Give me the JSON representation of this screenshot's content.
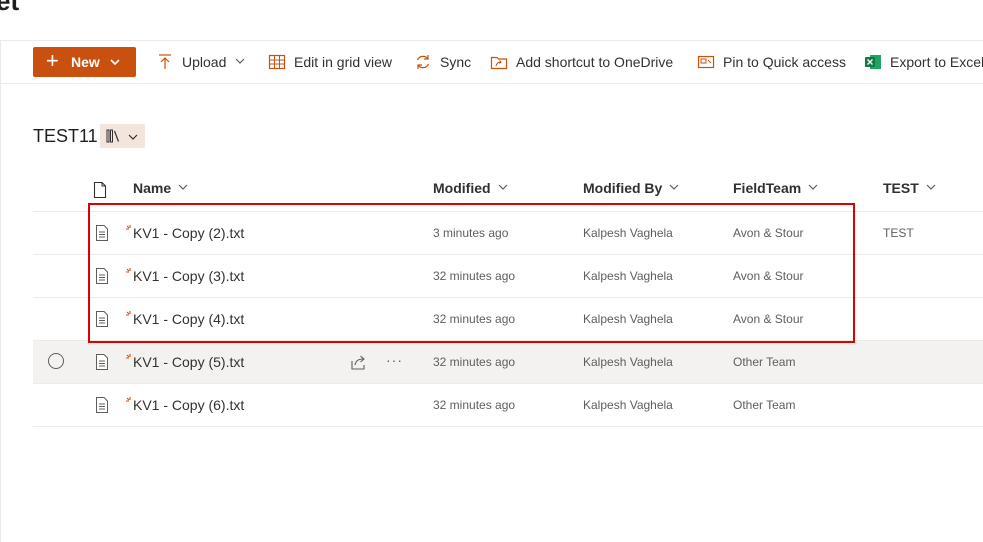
{
  "site": {
    "title_fragment": "et"
  },
  "commands": {
    "new_label": "New",
    "upload_label": "Upload",
    "grid_label": "Edit in grid view",
    "sync_label": "Sync",
    "shortcut_label": "Add shortcut to OneDrive",
    "pin_label": "Pin to Quick access",
    "export_label": "Export to Excel"
  },
  "library": {
    "title": "TEST11"
  },
  "columns": {
    "name": "Name",
    "modified": "Modified",
    "modified_by": "Modified By",
    "field_team": "FieldTeam",
    "test": "TEST"
  },
  "rows": [
    {
      "name": "KV1 - Copy (2).txt",
      "modified": "3 minutes ago",
      "modified_by": "Kalpesh Vaghela",
      "field_team": "Avon & Stour",
      "test": "TEST"
    },
    {
      "name": "KV1 - Copy (3).txt",
      "modified": "32 minutes ago",
      "modified_by": "Kalpesh Vaghela",
      "field_team": "Avon & Stour",
      "test": ""
    },
    {
      "name": "KV1 - Copy (4).txt",
      "modified": "32 minutes ago",
      "modified_by": "Kalpesh Vaghela",
      "field_team": "Avon & Stour",
      "test": ""
    },
    {
      "name": "KV1 - Copy (5).txt",
      "modified": "32 minutes ago",
      "modified_by": "Kalpesh Vaghela",
      "field_team": "Other Team",
      "test": ""
    },
    {
      "name": "KV1 - Copy (6).txt",
      "modified": "32 minutes ago",
      "modified_by": "Kalpesh Vaghela",
      "field_team": "Other Team",
      "test": ""
    }
  ],
  "colors": {
    "accent": "#ca5010",
    "highlight": "#e00000",
    "hover_row": "#f3f2f1"
  }
}
